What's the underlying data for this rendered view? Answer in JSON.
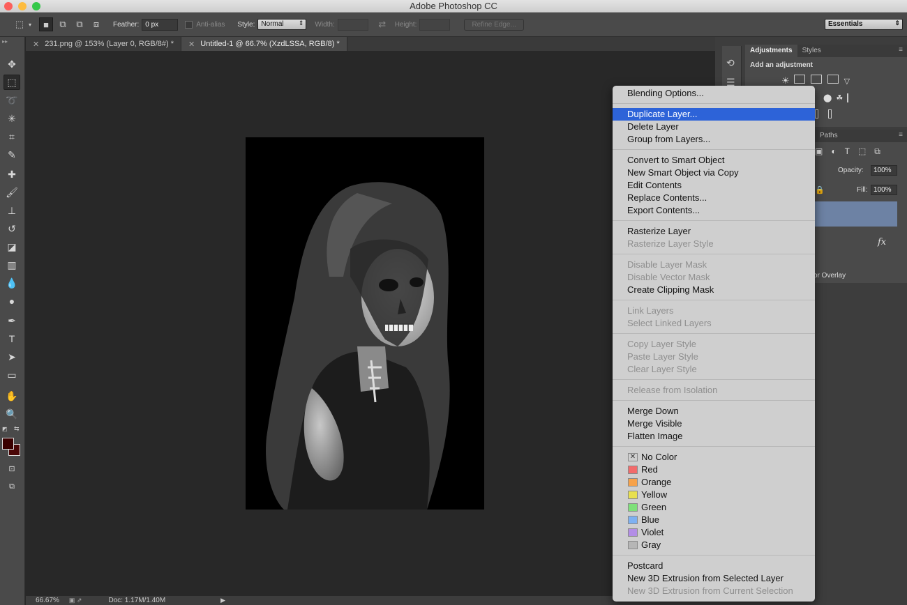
{
  "app": {
    "title": "Adobe Photoshop CC"
  },
  "options": {
    "feather_label": "Feather:",
    "feather_value": "0 px",
    "antialias_label": "Anti-alias",
    "style_label": "Style:",
    "style_value": "Normal",
    "width_label": "Width:",
    "height_label": "Height:",
    "refine_label": "Refine Edge...",
    "workspace": "Essentials"
  },
  "tabs": [
    {
      "label": "231.png @ 153% (Layer 0, RGB/8#) *"
    },
    {
      "label": "Untitled-1 @ 66.7% (XzdLSSA, RGB/8) *"
    }
  ],
  "status": {
    "zoom": "66.67%",
    "doc": "Doc: 1.17M/1.40M"
  },
  "panels": {
    "adjustments_tab": "Adjustments",
    "styles_tab": "Styles",
    "add_adjustment": "Add an adjustment",
    "paths_tab": "Paths",
    "opacity_label": "Opacity:",
    "opacity_value": "100%",
    "fill_label": "Fill:",
    "fill_value": "100%",
    "fx": "fx",
    "effect_label": "or Overlay"
  },
  "menu": {
    "items": [
      {
        "label": "Blending Options...",
        "state": "normal"
      },
      {
        "label": "Duplicate Layer...",
        "state": "highlighted"
      },
      {
        "label": "Delete Layer",
        "state": "normal"
      },
      {
        "label": "Group from Layers...",
        "state": "normal"
      },
      {
        "label": "Convert to Smart Object",
        "state": "normal"
      },
      {
        "label": "New Smart Object via Copy",
        "state": "normal"
      },
      {
        "label": "Edit Contents",
        "state": "normal"
      },
      {
        "label": "Replace Contents...",
        "state": "normal"
      },
      {
        "label": "Export Contents...",
        "state": "normal"
      },
      {
        "label": "Rasterize Layer",
        "state": "normal"
      },
      {
        "label": "Rasterize Layer Style",
        "state": "disabled"
      },
      {
        "label": "Disable Layer Mask",
        "state": "disabled"
      },
      {
        "label": "Disable Vector Mask",
        "state": "disabled"
      },
      {
        "label": "Create Clipping Mask",
        "state": "normal"
      },
      {
        "label": "Link Layers",
        "state": "disabled"
      },
      {
        "label": "Select Linked Layers",
        "state": "disabled"
      },
      {
        "label": "Copy Layer Style",
        "state": "disabled"
      },
      {
        "label": "Paste Layer Style",
        "state": "disabled"
      },
      {
        "label": "Clear Layer Style",
        "state": "disabled"
      },
      {
        "label": "Release from Isolation",
        "state": "disabled"
      },
      {
        "label": "Merge Down",
        "state": "normal"
      },
      {
        "label": "Merge Visible",
        "state": "normal"
      },
      {
        "label": "Flatten Image",
        "state": "normal"
      },
      {
        "label": "Postcard",
        "state": "normal"
      },
      {
        "label": "New 3D Extrusion from Selected Layer",
        "state": "normal"
      },
      {
        "label": "New 3D Extrusion from Current Selection",
        "state": "disabled"
      }
    ],
    "colors": [
      {
        "label": "No Color",
        "hex": "none"
      },
      {
        "label": "Red",
        "hex": "#f26b6b"
      },
      {
        "label": "Orange",
        "hex": "#f7a24a"
      },
      {
        "label": "Yellow",
        "hex": "#e8e04f"
      },
      {
        "label": "Green",
        "hex": "#7fe07a"
      },
      {
        "label": "Blue",
        "hex": "#7eb1f2"
      },
      {
        "label": "Violet",
        "hex": "#b38ee6"
      },
      {
        "label": "Gray",
        "hex": "#b6b6b6"
      }
    ]
  }
}
